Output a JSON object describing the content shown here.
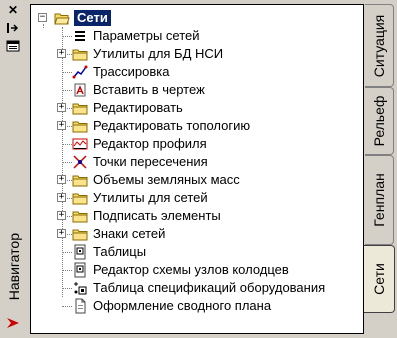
{
  "panel_title": "Навигатор",
  "tree": {
    "root": "Сети",
    "items": [
      {
        "label": "Параметры сетей",
        "icon": "list-icon",
        "expandable": false
      },
      {
        "label": "Утилиты для БД НСИ",
        "icon": "folder-icon",
        "expandable": true
      },
      {
        "label": "Трассировка",
        "icon": "route-icon",
        "expandable": false
      },
      {
        "label": "Вставить в чертеж",
        "icon": "insert-drawing-icon",
        "expandable": false
      },
      {
        "label": "Редактировать",
        "icon": "folder-icon",
        "expandable": true
      },
      {
        "label": "Редактировать топологию",
        "icon": "folder-icon",
        "expandable": true
      },
      {
        "label": "Редактор профиля",
        "icon": "profile-editor-icon",
        "expandable": false
      },
      {
        "label": "Точки пересечения",
        "icon": "intersection-icon",
        "expandable": false
      },
      {
        "label": "Объемы земляных масс",
        "icon": "folder-icon",
        "expandable": true
      },
      {
        "label": "Утилиты для сетей",
        "icon": "folder-icon",
        "expandable": true
      },
      {
        "label": "Подписать элементы",
        "icon": "folder-icon",
        "expandable": true
      },
      {
        "label": "Знаки сетей",
        "icon": "folder-icon",
        "expandable": true
      },
      {
        "label": "Таблицы",
        "icon": "table-doc-icon",
        "expandable": false
      },
      {
        "label": "Редактор схемы узлов колодцев",
        "icon": "table-doc-icon",
        "expandable": false
      },
      {
        "label": "Таблица спецификаций оборудования",
        "icon": "spec-table-icon",
        "expandable": false
      },
      {
        "label": "Оформление сводного плана",
        "icon": "document-icon",
        "expandable": false
      }
    ]
  },
  "tabs": [
    {
      "label": "Ситуация",
      "active": false
    },
    {
      "label": "Рельеф",
      "active": false
    },
    {
      "label": "Генплан",
      "active": false
    },
    {
      "label": "Сети",
      "active": true
    }
  ],
  "colors": {
    "selection": "#0a246a",
    "folder": "#f5d96b",
    "accent_red": "#cc0000"
  }
}
